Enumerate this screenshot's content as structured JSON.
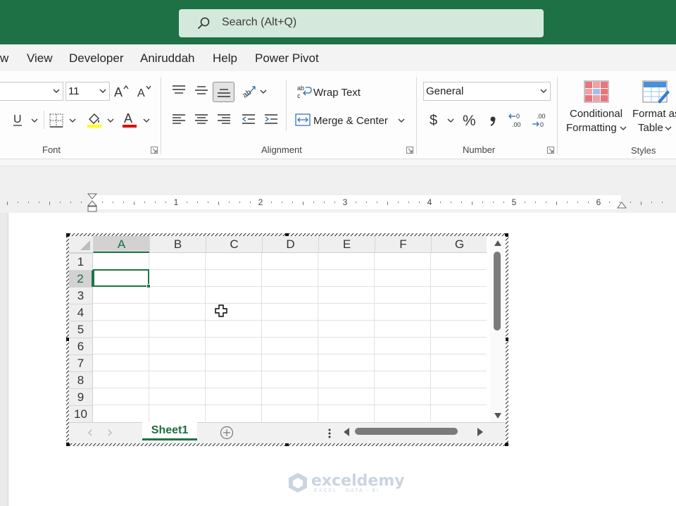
{
  "search": {
    "placeholder": "Search (Alt+Q)"
  },
  "menu": {
    "tabs": [
      "w",
      "View",
      "Developer",
      "Aniruddah",
      "Help",
      "Power Pivot"
    ]
  },
  "ribbon": {
    "font": {
      "size": "11",
      "group_label": "Font"
    },
    "alignment": {
      "wrap_text": "Wrap Text",
      "merge_center": "Merge & Center",
      "group_label": "Alignment"
    },
    "number": {
      "format": "General",
      "group_label": "Number"
    },
    "styles": {
      "conditional_line1": "Conditional",
      "conditional_line2": "Formatting",
      "format_table_line1": "Format as",
      "format_table_line2": "Table",
      "group_label": "Styles"
    },
    "colors": {
      "highlight": "#ffff00",
      "font_color": "#e00000"
    }
  },
  "ruler": {
    "numbers": [
      "1",
      "2",
      "3",
      "4",
      "5",
      "6"
    ]
  },
  "sheet": {
    "columns": [
      "A",
      "B",
      "C",
      "D",
      "E",
      "F",
      "G"
    ],
    "rows": [
      "1",
      "2",
      "3",
      "4",
      "5",
      "6",
      "7",
      "8",
      "9",
      "10"
    ],
    "active_cell": "A2",
    "tab_name": "Sheet1"
  },
  "watermark": {
    "title": "exceldemy",
    "subtitle": "EXCEL · DATA · BI"
  },
  "theme": {
    "accent": "#217346",
    "titlebar": "#1e7145"
  }
}
